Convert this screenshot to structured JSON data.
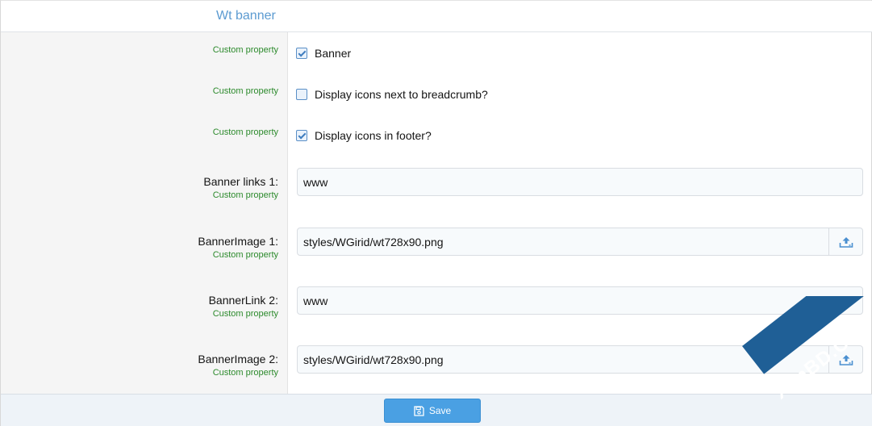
{
  "header": {
    "title": "Wt banner"
  },
  "rows": [
    {
      "hint": "Custom property",
      "type": "checkbox",
      "label": "Banner",
      "checked": true
    },
    {
      "hint": "Custom property",
      "type": "checkbox",
      "label": "Display icons next to breadcrumb?",
      "checked": false
    },
    {
      "hint": "Custom property",
      "type": "checkbox",
      "label": "Display icons in footer?",
      "checked": true
    },
    {
      "label": "Banner links 1:",
      "hint": "Custom property",
      "type": "text",
      "value": "www"
    },
    {
      "label": "BannerImage 1:",
      "hint": "Custom property",
      "type": "upload",
      "value": "styles/WGirid/wt728x90.png"
    },
    {
      "label": "BannerLink 2:",
      "hint": "Custom property",
      "type": "text",
      "value": "www"
    },
    {
      "label": "BannerImage 2:",
      "hint": "Custom property",
      "type": "upload",
      "value": "styles/WGirid/wt728x90.png"
    }
  ],
  "footer": {
    "save_label": "Save"
  },
  "watermark": {
    "text": "XenBD.Com"
  },
  "colors": {
    "accent": "#5c9bd1",
    "hint": "#2c8a2c",
    "button": "#4aa0e3",
    "watermark": "#1f5f96"
  },
  "icons": {
    "upload": "upload-icon",
    "save": "save-icon",
    "check": "checkmark-icon"
  }
}
